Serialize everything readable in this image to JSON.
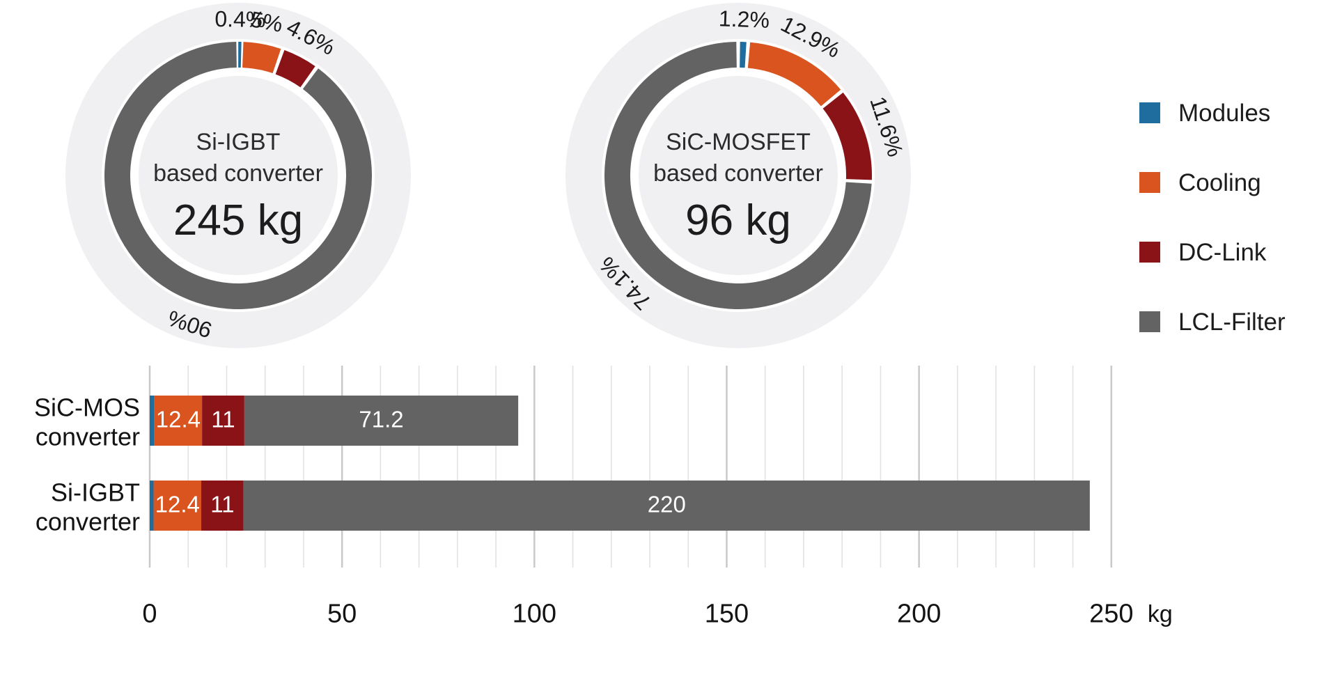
{
  "colors": {
    "modules": "#1f6d9e",
    "cooling": "#d9541f",
    "dclink": "#8a1317",
    "lcl": "#636363",
    "ring_bg": "#f0f0f2",
    "grid": "#d6d6d6",
    "text": "#1a1a1a"
  },
  "legend": {
    "items": [
      {
        "label": "Modules",
        "color": "#1f6d9e"
      },
      {
        "label": "Cooling",
        "color": "#d9541f"
      },
      {
        "label": "DC-Link",
        "color": "#8a1317"
      },
      {
        "label": "LCL-Filter",
        "color": "#636363"
      }
    ]
  },
  "donuts": [
    {
      "name": "si-igbt-donut",
      "title_line1": "Si-IGBT",
      "title_line2": "based converter",
      "mass": "245 kg",
      "labels": [
        "0.4%",
        "5%",
        "4.6%",
        "90%"
      ]
    },
    {
      "name": "sic-mosfet-donut",
      "title_line1": "SiC-MOSFET",
      "title_line2": "based converter",
      "mass": "96 kg",
      "labels": [
        "1.2%",
        "12.9%",
        "11.6%",
        "74.1%"
      ]
    }
  ],
  "chart_data": [
    {
      "type": "pie",
      "title": "Si-IGBT based converter",
      "subtitle": "245 kg",
      "labels": [
        "Modules",
        "Cooling",
        "DC-Link",
        "LCL-Filter"
      ],
      "values": [
        0.4,
        5.0,
        4.6,
        90.0
      ],
      "value_labels": [
        "0.4%",
        "5%",
        "4.6%",
        "90%"
      ],
      "colors": [
        "#1f6d9e",
        "#d9541f",
        "#8a1317",
        "#636363"
      ],
      "units": "%",
      "legend_position": "right"
    },
    {
      "type": "pie",
      "title": "SiC-MOSFET based converter",
      "subtitle": "96 kg",
      "labels": [
        "Modules",
        "Cooling",
        "DC-Link",
        "LCL-Filter"
      ],
      "values": [
        1.2,
        12.9,
        11.6,
        74.1
      ],
      "value_labels": [
        "1.2%",
        "12.9%",
        "11.6%",
        "74.1%"
      ],
      "colors": [
        "#1f6d9e",
        "#d9541f",
        "#8a1317",
        "#636363"
      ],
      "units": "%",
      "legend_position": "right"
    },
    {
      "type": "bar",
      "orientation": "horizontal",
      "stacked": true,
      "title": "",
      "xlabel": "kg",
      "ylabel": "",
      "xlim": [
        0,
        258
      ],
      "xticks": [
        0,
        50,
        100,
        150,
        200,
        250
      ],
      "xtick_labels": [
        "0",
        "50",
        "100",
        "150",
        "200",
        "250"
      ],
      "minor_gridlines": true,
      "minor_tick_step": 10,
      "grid": true,
      "unit_suffix": "kg",
      "categories": [
        "SiC-MOS converter",
        "Si-IGBT converter"
      ],
      "category_lines": [
        [
          "SiC-MOS",
          "converter"
        ],
        [
          "Si-IGBT",
          "converter"
        ]
      ],
      "series": [
        {
          "name": "Modules",
          "color": "#1f6d9e",
          "values": [
            1.2,
            1.0
          ],
          "labels": [
            "",
            ""
          ]
        },
        {
          "name": "Cooling",
          "color": "#d9541f",
          "values": [
            12.4,
            12.4
          ],
          "labels": [
            "12.4",
            "12.4"
          ]
        },
        {
          "name": "DC-Link",
          "color": "#8a1317",
          "values": [
            11.0,
            11.0
          ],
          "labels": [
            "11",
            "11"
          ]
        },
        {
          "name": "LCL-Filter",
          "color": "#636363",
          "values": [
            71.2,
            220.0
          ],
          "labels": [
            "71.2",
            "220"
          ]
        }
      ],
      "totals": [
        95.8,
        244.4
      ]
    }
  ]
}
